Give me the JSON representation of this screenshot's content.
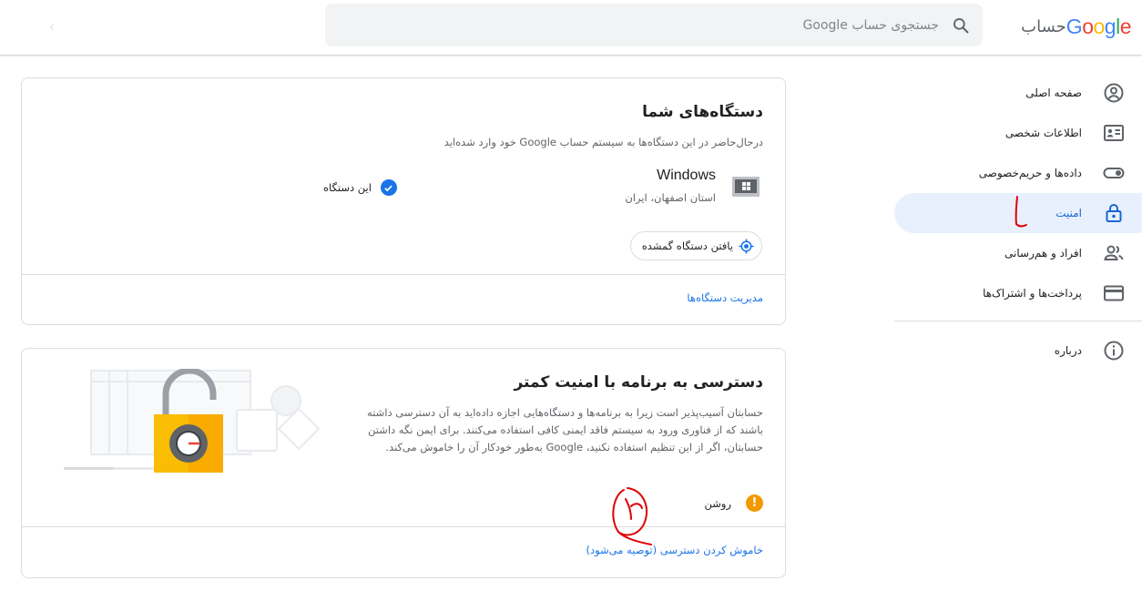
{
  "header": {
    "logo_text": "Google",
    "product": "حساب",
    "search_placeholder": "جستجوی حساب Google"
  },
  "sidebar": {
    "items": [
      {
        "label": "صفحه اصلی",
        "icon": "home-icon"
      },
      {
        "label": "اطلاعات شخصی",
        "icon": "person-card-icon"
      },
      {
        "label": "داده‌ها و حریم‌خصوصی",
        "icon": "toggle-icon"
      },
      {
        "label": "امنیت",
        "icon": "lock-icon",
        "active": true
      },
      {
        "label": "افراد و هم‌رسانی",
        "icon": "people-icon"
      },
      {
        "label": "پرداخت‌ها و اشتراک‌ها",
        "icon": "credit-card-icon"
      }
    ],
    "about": {
      "label": "درباره",
      "icon": "info-icon"
    }
  },
  "devices_card": {
    "title": "دستگاه‌های شما",
    "description": "درحال‌حاضر در این دستگاه‌ها به سیستم حساب Google خود وارد شده‌اید",
    "device_name": "Windows",
    "device_location": "استان اصفهان، ایران",
    "this_device": "این دستگاه",
    "find_button": "یافتن دستگاه گمشده",
    "manage_link": "مدیریت دستگاه‌ها"
  },
  "less_secure_card": {
    "title": "دسترسی به برنامه با امنیت کمتر",
    "description": "حسابتان آسیب‌پذیر است زیرا به برنامه‌ها و دستگاه‌هایی اجازه داده‌اید به آن دسترسی داشته باشند که از فناوری ورود به سیستم فاقد ایمنی کافی استفاده می‌کنند. برای ایمن نگه داشتن حسابتان، اگر از این تنظیم استفاده نکنید، Google به‌طور خودکار آن را خاموش می‌کند.",
    "status": "روشن",
    "turn_off_link": "خاموش کردن دسترسی (توصیه می‌شود)"
  },
  "colors": {
    "accent": "#1a73e8",
    "active_bg": "#e8f0fe",
    "warning": "#f29900",
    "annotation": "#e00000"
  }
}
